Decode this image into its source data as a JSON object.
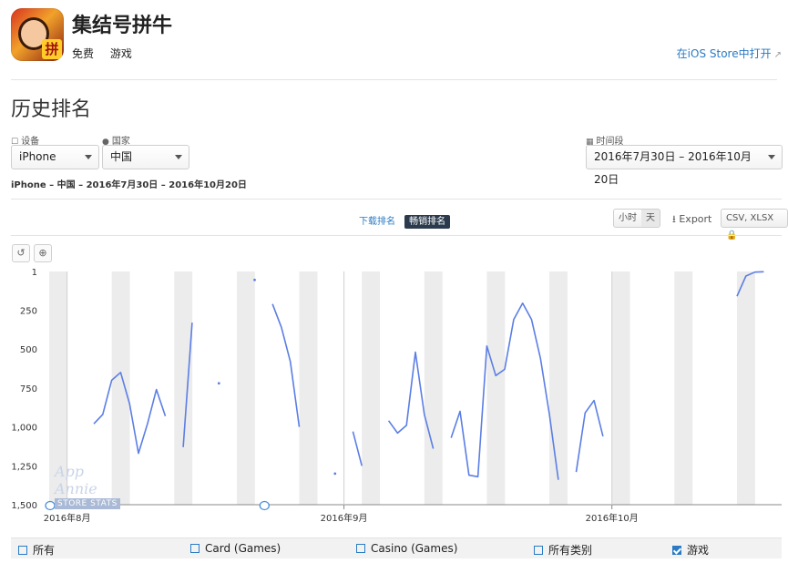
{
  "app": {
    "name": "集结号拼牛",
    "icon_glyph": "拼",
    "price": "免费",
    "category": "游戏",
    "open_store_link": "在iOS Store中打开",
    "external_icon": "external-link-icon"
  },
  "section_title": "历史排名",
  "filters": {
    "device": {
      "label": "设备",
      "value": "iPhone"
    },
    "country": {
      "label": "国家",
      "value": "中国"
    },
    "period": {
      "label": "时间段",
      "value": "2016年7月30日 – 2016年10月20日"
    }
  },
  "summary": "iPhone – 中国 – 2016年7月30日 – 2016年10月20日",
  "rank_tabs": {
    "download": "下载排名",
    "grossing": "畅销排名",
    "active": "grossing"
  },
  "granularity": {
    "hour": "小时",
    "day": "天",
    "active": "day"
  },
  "export": {
    "label": "Export",
    "formats": "CSV, XLSX"
  },
  "tools": {
    "reset_icon": "undo-icon",
    "zoom_icon": "zoom-in-icon"
  },
  "watermark": {
    "line1": "App Annie",
    "line2": "STORE STATS"
  },
  "legend": [
    {
      "label": "所有",
      "checked": false
    },
    {
      "label": "Card (Games)",
      "checked": false
    },
    {
      "label": "Casino (Games)",
      "checked": false
    },
    {
      "label": "所有类别",
      "checked": false
    },
    {
      "label": "游戏",
      "checked": true
    }
  ],
  "chart_data": {
    "type": "line",
    "y_ticks": [
      "1",
      "250",
      "500",
      "750",
      "1,000",
      "1,250",
      "1,500"
    ],
    "y_reversed": true,
    "ylim": [
      1,
      1500
    ],
    "x_ticks": [
      "2016年8月",
      "2016年9月",
      "2016年10月"
    ],
    "line_color": "#5b7ee5",
    "series": [
      {
        "segments": [
          [
            [
              "2016-08-04",
              980
            ],
            [
              "2016-08-05",
              920
            ],
            [
              "2016-08-06",
              700
            ],
            [
              "2016-08-07",
              650
            ],
            [
              "2016-08-08",
              850
            ],
            [
              "2016-08-09",
              1170
            ],
            [
              "2016-08-10",
              980
            ],
            [
              "2016-08-11",
              760
            ],
            [
              "2016-08-12",
              930
            ]
          ],
          [
            [
              "2016-08-14",
              1130
            ],
            [
              "2016-08-15",
              330
            ]
          ],
          [
            [
              "2016-08-18",
              720
            ]
          ],
          [
            [
              "2016-08-22",
              55
            ]
          ],
          [
            [
              "2016-08-24",
              210
            ],
            [
              "2016-08-25",
              360
            ],
            [
              "2016-08-26",
              580
            ],
            [
              "2016-08-27",
              1000
            ]
          ],
          [
            [
              "2016-08-31",
              1300
            ]
          ],
          [
            [
              "2016-09-02",
              1030
            ],
            [
              "2016-09-03",
              1250
            ]
          ],
          [
            [
              "2016-09-06",
              960
            ],
            [
              "2016-09-07",
              1040
            ],
            [
              "2016-09-08",
              990
            ],
            [
              "2016-09-09",
              520
            ],
            [
              "2016-09-10",
              920
            ],
            [
              "2016-09-11",
              1140
            ]
          ],
          [
            [
              "2016-09-13",
              1070
            ],
            [
              "2016-09-14",
              900
            ],
            [
              "2016-09-15",
              1310
            ],
            [
              "2016-09-16",
              1320
            ],
            [
              "2016-09-17",
              480
            ],
            [
              "2016-09-18",
              670
            ],
            [
              "2016-09-19",
              630
            ],
            [
              "2016-09-20",
              310
            ],
            [
              "2016-09-21",
              205
            ],
            [
              "2016-09-22",
              310
            ],
            [
              "2016-09-23",
              560
            ],
            [
              "2016-09-24",
              920
            ],
            [
              "2016-09-25",
              1340
            ]
          ],
          [
            [
              "2016-09-27",
              1290
            ],
            [
              "2016-09-28",
              910
            ],
            [
              "2016-09-29",
              830
            ],
            [
              "2016-09-30",
              1060
            ]
          ],
          [
            [
              "2016-10-15",
              160
            ],
            [
              "2016-10-16",
              30
            ],
            [
              "2016-10-17",
              5
            ],
            [
              "2016-10-18",
              3
            ]
          ]
        ]
      }
    ],
    "weekend_bands": true,
    "grid": false
  }
}
